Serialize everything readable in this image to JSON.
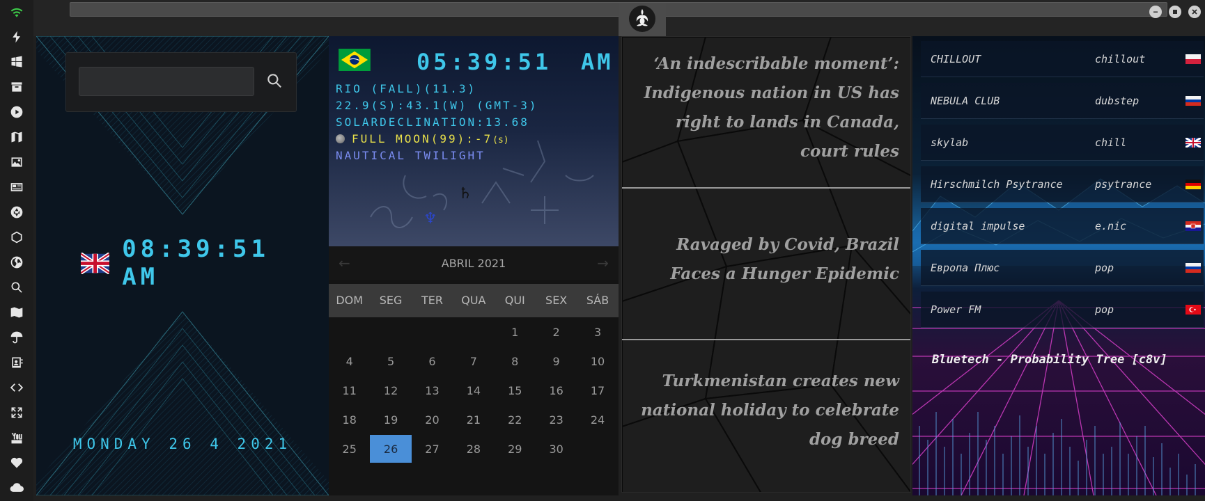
{
  "window": {
    "title": "",
    "controls": [
      "minimize",
      "maximize",
      "close"
    ]
  },
  "rail": {
    "icons": [
      "wifi-icon",
      "lightning-icon",
      "windows-icon",
      "archive-icon",
      "play-icon",
      "map-book-icon",
      "image-icon",
      "news-icon",
      "aperture-icon",
      "hexagon-icon",
      "globe-icon",
      "search-icon",
      "map-icon",
      "umbrella-icon",
      "contact-icon",
      "code-icon",
      "expand-icon",
      "youtube-icon",
      "heart-icon",
      "cloud-icon"
    ]
  },
  "clock": {
    "search_placeholder": "",
    "uk_time": "08:39:51 AM",
    "date": "MONDAY 26 4 2021"
  },
  "astro": {
    "time": "05:39:51",
    "ampm": "AM",
    "location": "RIO (FALL)(11.3)",
    "coords": "22.9(S):43.1(W) (GMT-3)",
    "solar": "SOLARDECLINATION:13.68",
    "moon": "FULL MOON(99):-7",
    "moon_suffix": "(s)",
    "twilight": "NAUTICAL TWILIGHT",
    "colors": {
      "digital": "#3fc7ea",
      "moon": "#e8e04a",
      "twilight": "#7a8cf0"
    }
  },
  "calendar": {
    "month": "ABRIL 2021",
    "prev": "←",
    "next": "→",
    "weekdays": [
      "DOM",
      "SEG",
      "TER",
      "QUA",
      "QUI",
      "SEX",
      "SÁB"
    ],
    "weeks": [
      [
        "",
        "",
        "",
        "",
        "1",
        "2",
        "3"
      ],
      [
        "4",
        "5",
        "6",
        "7",
        "8",
        "9",
        "10"
      ],
      [
        "11",
        "12",
        "13",
        "14",
        "15",
        "16",
        "17"
      ],
      [
        "18",
        "19",
        "20",
        "21",
        "22",
        "23",
        "24"
      ],
      [
        "25",
        "26",
        "27",
        "28",
        "29",
        "30",
        ""
      ]
    ],
    "today": "26",
    "today_color": "#4a8fd8"
  },
  "news": [
    {
      "headline": "‘An indescribable moment’: Indigenous nation in US has right to lands in Canada, court rules"
    },
    {
      "headline": "Ravaged by Covid, Brazil Faces a Hunger Epidemic"
    },
    {
      "headline": "Turkmenistan creates new national holiday to celebrate dog breed"
    }
  ],
  "radio": {
    "stations": [
      {
        "name": "CHILLOUT",
        "genre": "chillout",
        "flag": "poland"
      },
      {
        "name": "NEBULA CLUB",
        "genre": "dubstep",
        "flag": "russia"
      },
      {
        "name": "skylab",
        "genre": "chill",
        "flag": "uk"
      },
      {
        "name": "Hirschmilch Psytrance",
        "genre": "psytrance",
        "flag": "germany"
      },
      {
        "name": "digital impulse",
        "genre": "e.nic",
        "flag": "croatia"
      },
      {
        "name": "Европа Плюс",
        "genre": "pop",
        "flag": "russia"
      },
      {
        "name": "Power FM",
        "genre": "pop",
        "flag": "turkey"
      }
    ],
    "now_playing": "Bluetech - Probability Tree [c8v]"
  }
}
